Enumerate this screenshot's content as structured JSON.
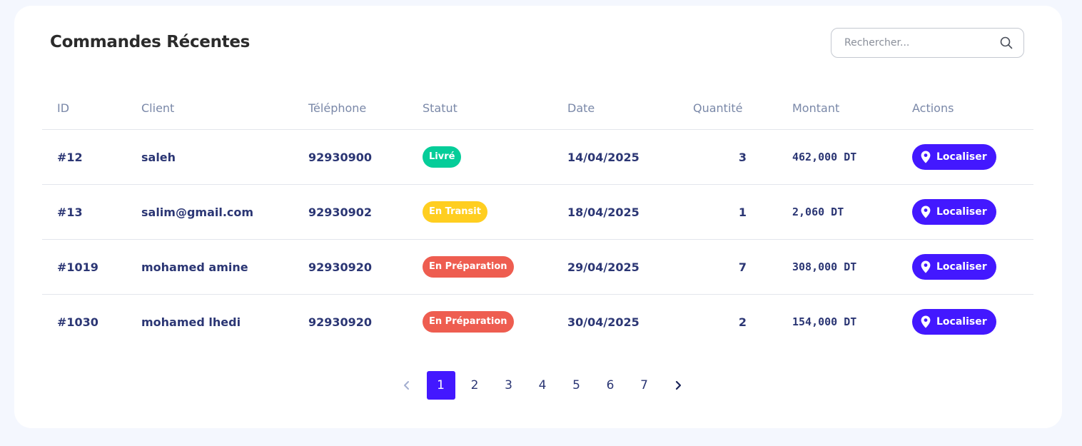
{
  "header": {
    "title": "Commandes Récentes"
  },
  "search": {
    "placeholder": "Rechercher..."
  },
  "table": {
    "columns": [
      "ID",
      "Client",
      "Téléphone",
      "Statut",
      "Date",
      "Quantité",
      "Montant",
      "Actions"
    ],
    "rows": [
      {
        "id": "#12",
        "client": "saleh",
        "phone": "92930900",
        "status": "Livré",
        "status_color": "#05cd99",
        "date": "14/04/2025",
        "qty": "3",
        "amount": "462,000 DT",
        "action": "Localiser"
      },
      {
        "id": "#13",
        "client": "salim@gmail.com",
        "phone": "92930902",
        "status": "En Transit",
        "status_color": "#ffce20",
        "date": "18/04/2025",
        "qty": "1",
        "amount": "2,060 DT",
        "action": "Localiser"
      },
      {
        "id": "#1019",
        "client": "mohamed amine",
        "phone": "92930920",
        "status": "En Préparation",
        "status_color": "#ee5d50",
        "date": "29/04/2025",
        "qty": "7",
        "amount": "308,000 DT",
        "action": "Localiser"
      },
      {
        "id": "#1030",
        "client": "mohamed lhedi",
        "phone": "92930920",
        "status": "En Préparation",
        "status_color": "#ee5d50",
        "date": "30/04/2025",
        "qty": "2",
        "amount": "154,000 DT",
        "action": "Localiser"
      }
    ]
  },
  "pagination": {
    "pages": [
      "1",
      "2",
      "3",
      "4",
      "5",
      "6",
      "7"
    ],
    "current": "1",
    "prev_icon": "chevron-left-icon",
    "next_icon": "chevron-right-icon"
  },
  "colors": {
    "accent": "#4318ff",
    "text": "#2b3674",
    "muted": "#7a88a8",
    "background": "#f4f7fe"
  }
}
